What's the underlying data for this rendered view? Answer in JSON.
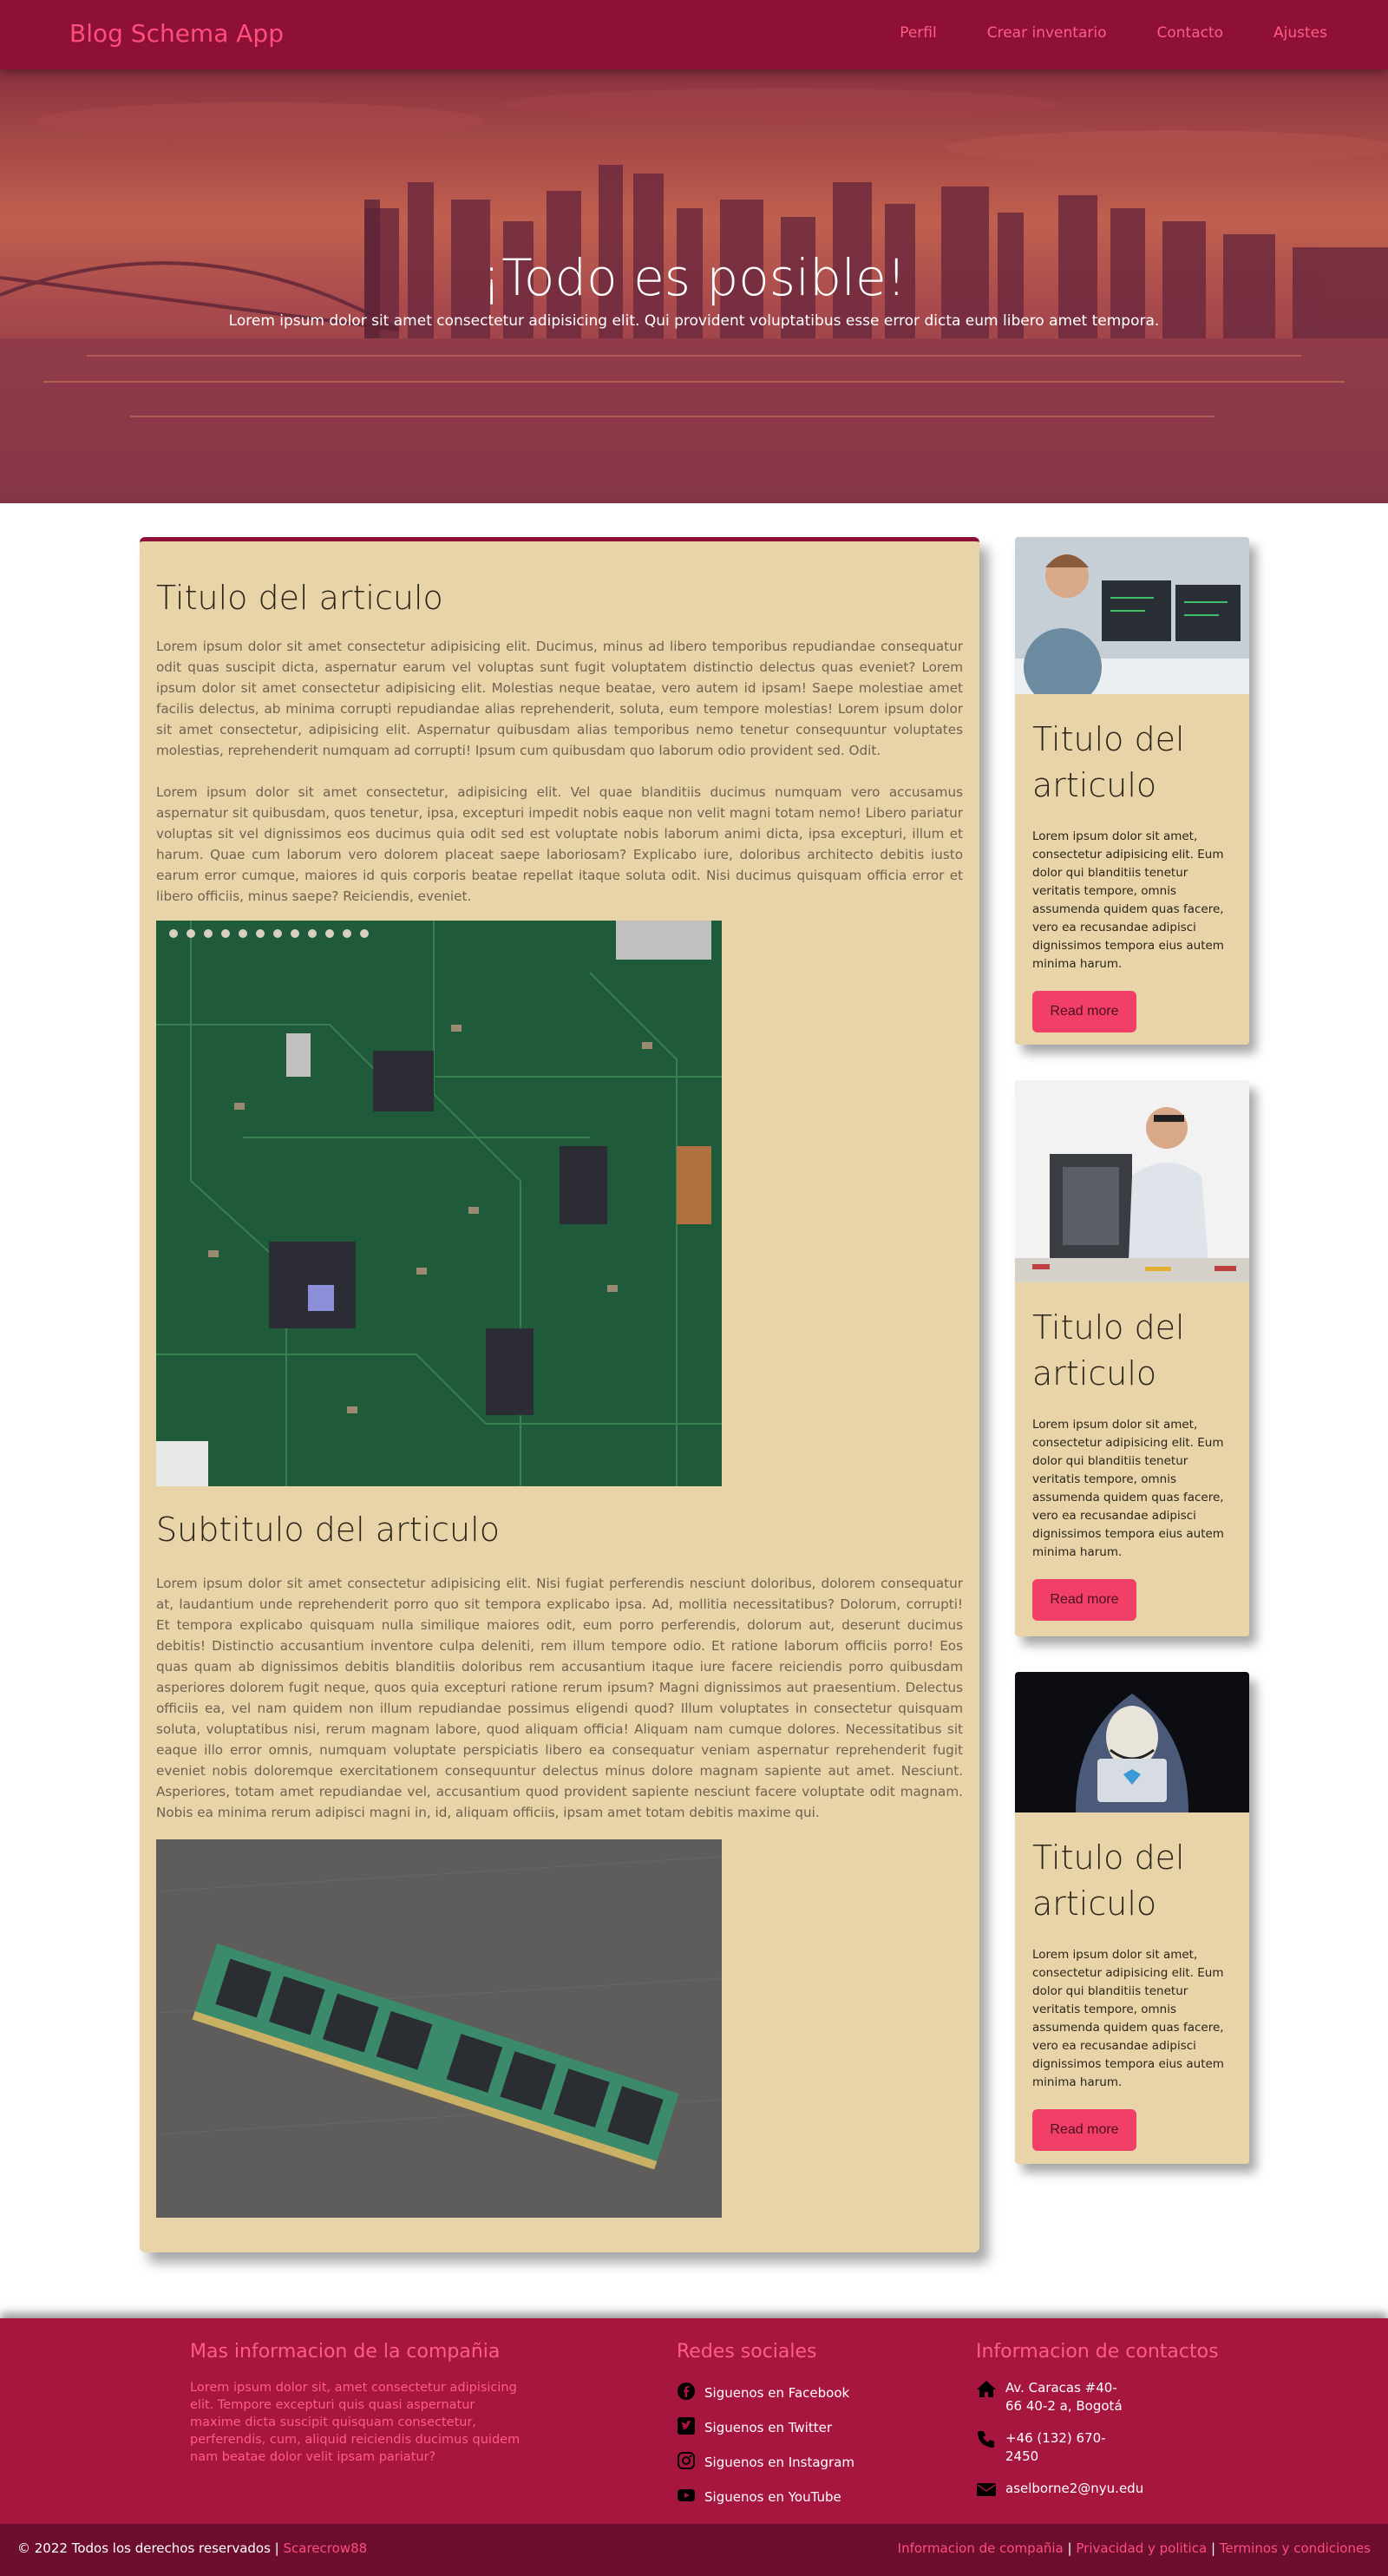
{
  "navbar": {
    "brand": "Blog Schema App",
    "links": [
      "Perfil",
      "Crear inventario",
      "Contacto",
      "Ajustes"
    ]
  },
  "hero": {
    "title": "¡Todo es posible!",
    "subtitle": "Lorem ipsum dolor sit amet consectetur adipisicing elit. Qui provident voluptatibus esse error dicta eum libero amet tempora."
  },
  "article": {
    "title": "Titulo del articulo",
    "paragraphs": [
      "Lorem ipsum dolor sit amet consectetur adipisicing elit. Ducimus, minus ad libero temporibus repudiandae consequatur odit quas suscipit dicta, aspernatur earum vel voluptas sunt fugit voluptatem distinctio delectus quas eveniet? Lorem ipsum dolor sit amet consectetur adipisicing elit. Molestias neque beatae, vero autem id ipsam! Saepe molestiae amet facilis delectus, ab minima corrupti repudiandae alias reprehenderit, soluta, eum tempore molestias! Lorem ipsum dolor sit amet consectetur, adipisicing elit. Aspernatur quibusdam alias temporibus nemo tenetur consequuntur voluptates molestias, reprehenderit numquam ad corrupti! Ipsum cum quibusdam quo laborum odio provident sed. Odit.",
      "Lorem ipsum dolor sit amet consectetur, adipisicing elit. Vel quae blanditiis ducimus numquam vero accusamus aspernatur sit quibusdam, quos tenetur, ipsa, excepturi impedit nobis eaque non velit magni totam nemo! Libero pariatur voluptas sit vel dignissimos eos ducimus quia odit sed est voluptate nobis laborum animi dicta, ipsa excepturi, illum et harum. Quae cum laborum vero dolorem placeat saepe laboriosam? Explicabo iure, doloribus architecto debitis iusto earum error cumque, maiores id quis corporis beatae repellat itaque soluta odit. Nisi ducimus quisquam officia error et libero officiis, minus saepe? Reiciendis, eveniet."
    ],
    "subtitle": "Subtitulo del articulo",
    "sub_paragraph": "Lorem ipsum dolor sit amet consectetur adipisicing elit. Nisi fugiat perferendis nesciunt doloribus, dolorem consequatur at, laudantium unde reprehenderit porro quo sit tempora explicabo ipsa. Ad, mollitia necessitatibus? Dolorum, corrupti! Et tempora explicabo quisquam nulla similique maiores odit, eum porro perferendis, dolorum aut, deserunt ducimus debitis! Distinctio accusantium inventore culpa deleniti, rem illum tempore odio. Et ratione laborum officiis porro! Eos quas quam ab dignissimos debitis blanditiis doloribus rem accusantium itaque iure facere reiciendis porro quibusdam asperiores dolorem fugit neque, quos quia excepturi ratione rerum ipsum? Magni dignissimos aut praesentium. Delectus officiis ea, vel nam quidem non illum repudiandae possimus eligendi quod? Illum voluptates in consectetur quisquam soluta, voluptatibus nisi, rerum magnam labore, quod aliquam officia! Aliquam nam cumque dolores. Necessitatibus sit eaque illo error omnis, numquam voluptate perspiciatis libero ea consequatur veniam aspernatur reprehenderit fugit eveniet nobis doloremque exercitationem consequuntur delectus minus dolore magnam sapiente aut amet. Nesciunt. Asperiores, totam amet repudiandae vel, accusantium quod provident sapiente nesciunt facere voluptate odit magnam. Nobis ea minima rerum adipisci magni in, id, aliquam officiis, ipsam amet totam debitis maxime qui."
  },
  "cards": [
    {
      "title": "Titulo del articulo",
      "text": "Lorem ipsum dolor sit amet, consectetur adipisicing elit. Eum dolor qui blanditiis tenetur veritatis tempore, omnis assumenda quidem quas facere, vero ea recusandae adipisci dignissimos tempora eius autem minima harum.",
      "button": "Read more"
    },
    {
      "title": "Titulo del articulo",
      "text": "Lorem ipsum dolor sit amet, consectetur adipisicing elit. Eum dolor qui blanditiis tenetur veritatis tempore, omnis assumenda quidem quas facere, vero ea recusandae adipisci dignissimos tempora eius autem minima harum.",
      "button": "Read more"
    },
    {
      "title": "Titulo del articulo",
      "text": "Lorem ipsum dolor sit amet, consectetur adipisicing elit. Eum dolor qui blanditiis tenetur veritatis tempore, omnis assumenda quidem quas facere, vero ea recusandae adipisci dignissimos tempora eius autem minima harum.",
      "button": "Read more"
    }
  ],
  "footer": {
    "company_title": "Mas informacion de la compañia",
    "company_text": "Lorem ipsum dolor sit, amet consectetur adipisicing elit. Tempore excepturi quis quasi aspernatur maxime dicta suscipit quisquam consectetur, perferendis, cum, aliquid reiciendis ducimus quidem nam beatae dolor velit ipsam pariatur?",
    "social_title": "Redes sociales",
    "social": [
      {
        "icon": "facebook-icon",
        "label": "Siguenos en Facebook"
      },
      {
        "icon": "twitter-icon",
        "label": "Siguenos en Twitter"
      },
      {
        "icon": "instagram-icon",
        "label": "Siguenos en Instagram"
      },
      {
        "icon": "youtube-icon",
        "label": "Siguenos en YouTube"
      }
    ],
    "contact_title": "Informacion de contactos",
    "address": "Av. Caracas #40-66 40-2 a, Bogotá",
    "phone": "+46 (132) 670-2450",
    "email": "aselborne2@nyu.edu"
  },
  "bottom": {
    "copyright": "© 2022 Todos los derechos reservados |",
    "author": "Scarecrow88",
    "links": [
      "Informacion de compañia",
      "Privacidad y politica",
      "Terminos y condiciones"
    ],
    "separator": "|"
  },
  "colors": {
    "navbar": "#8e1036",
    "accent": "#ff4d7d",
    "card_bg": "#e8d4a8",
    "button": "#f23f67",
    "footer": "#a6163f",
    "bottom_bar": "#6e0e2e"
  }
}
